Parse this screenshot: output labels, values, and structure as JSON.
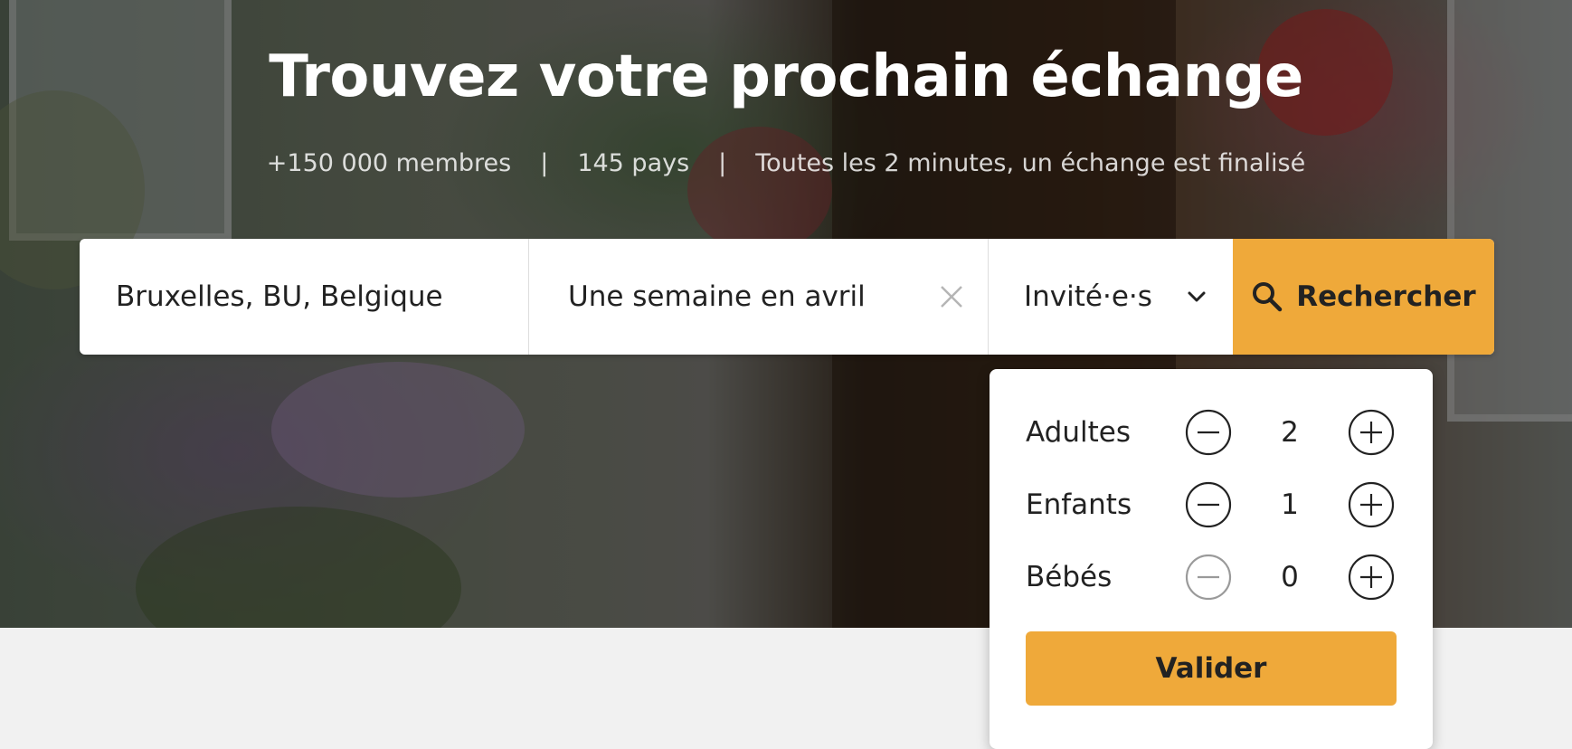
{
  "hero": {
    "title": "Trouvez votre prochain échange",
    "stats": [
      "+150 000 membres",
      "145 pays",
      "Toutes les 2 minutes, un échange est finalisé"
    ],
    "separator": "|"
  },
  "search": {
    "location_value": "Bruxelles, BU, Belgique",
    "dates_value": "Une semaine en avril",
    "guests_label": "Invité·e·s",
    "button_label": "Rechercher",
    "accent_color": "#efa93a"
  },
  "guests_popover": {
    "rows": [
      {
        "label": "Adultes",
        "value": "2",
        "minus_enabled": true
      },
      {
        "label": "Enfants",
        "value": "1",
        "minus_enabled": true
      },
      {
        "label": "Bébés",
        "value": "0",
        "minus_enabled": false
      }
    ],
    "validate_label": "Valider"
  },
  "icons": {
    "clear": "close-icon",
    "guests_dropdown": "chevron-down-icon",
    "search": "search-icon",
    "decrement": "minus-circle-icon",
    "increment": "plus-circle-icon"
  }
}
